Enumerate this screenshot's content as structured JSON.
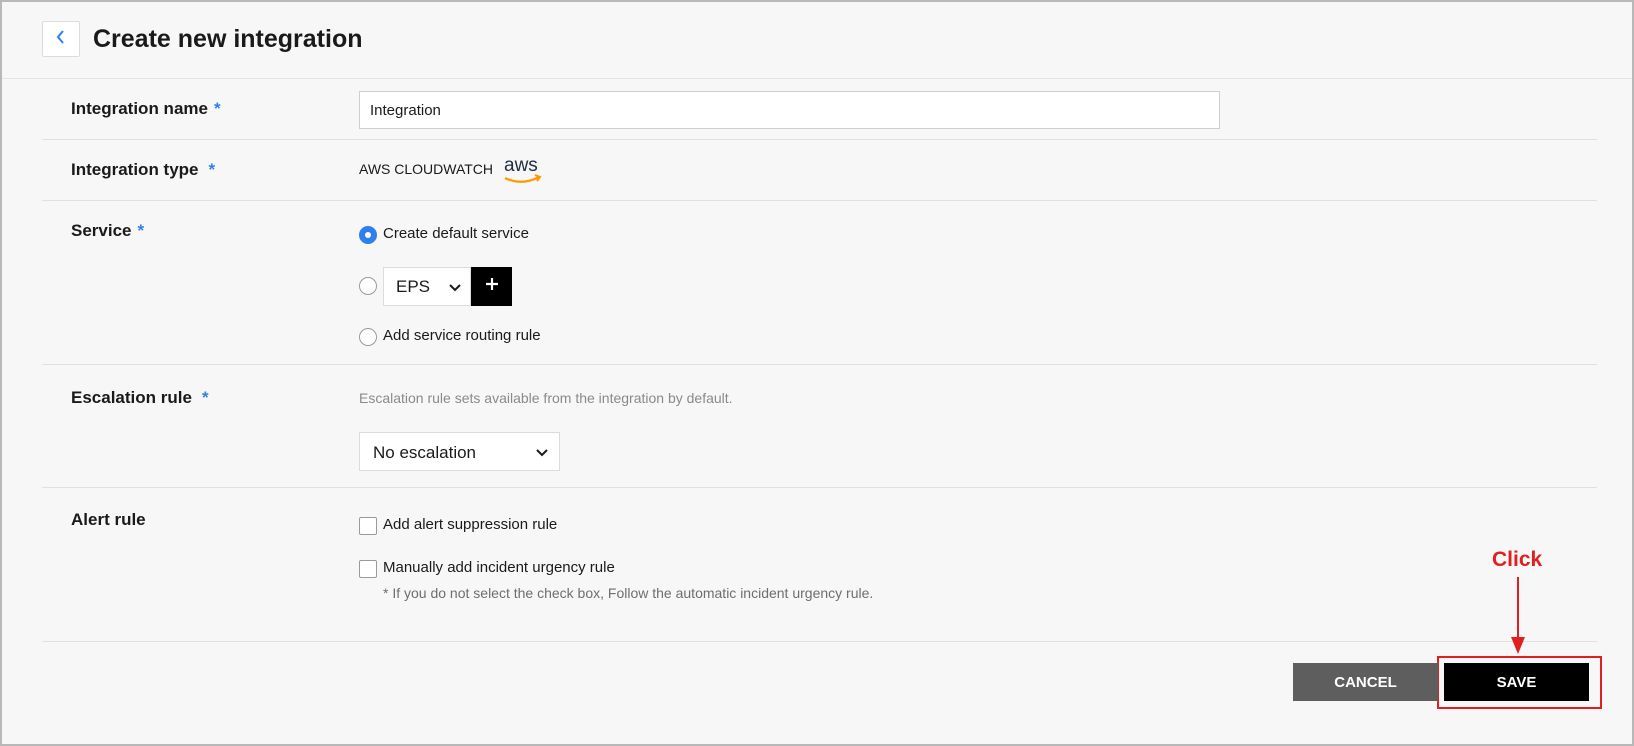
{
  "header": {
    "title": "Create new integration"
  },
  "form": {
    "name": {
      "label": "Integration name",
      "required_mark": "*",
      "value": "Integration"
    },
    "type": {
      "label": "Integration type",
      "required_mark": "*",
      "value": "AWS CLOUDWATCH",
      "logo_text": "aws"
    },
    "service": {
      "label": "Service",
      "required_mark": "*",
      "options": [
        {
          "label": "Create default service",
          "checked": true
        },
        {
          "select_value": "EPS",
          "checked": false
        },
        {
          "label": "Add service routing rule",
          "checked": false
        }
      ]
    },
    "escalation": {
      "label": "Escalation rule",
      "required_mark": "*",
      "hint": "Escalation rule sets available from the integration by default.",
      "select_value": "No escalation"
    },
    "alert": {
      "label": "Alert rule",
      "checkboxes": [
        {
          "label": "Add alert suppression rule",
          "checked": false
        },
        {
          "label": "Manually add incident urgency rule",
          "checked": false
        }
      ],
      "note": "* If you do not select the check box, Follow the automatic incident urgency rule."
    }
  },
  "actions": {
    "cancel_label": "CANCEL",
    "save_label": "SAVE"
  },
  "annotation": {
    "text": "Click",
    "color": "#e02020"
  },
  "colors": {
    "accent": "#2f80ed",
    "primary_button": "#000000",
    "secondary_button": "#5e5e5e"
  }
}
